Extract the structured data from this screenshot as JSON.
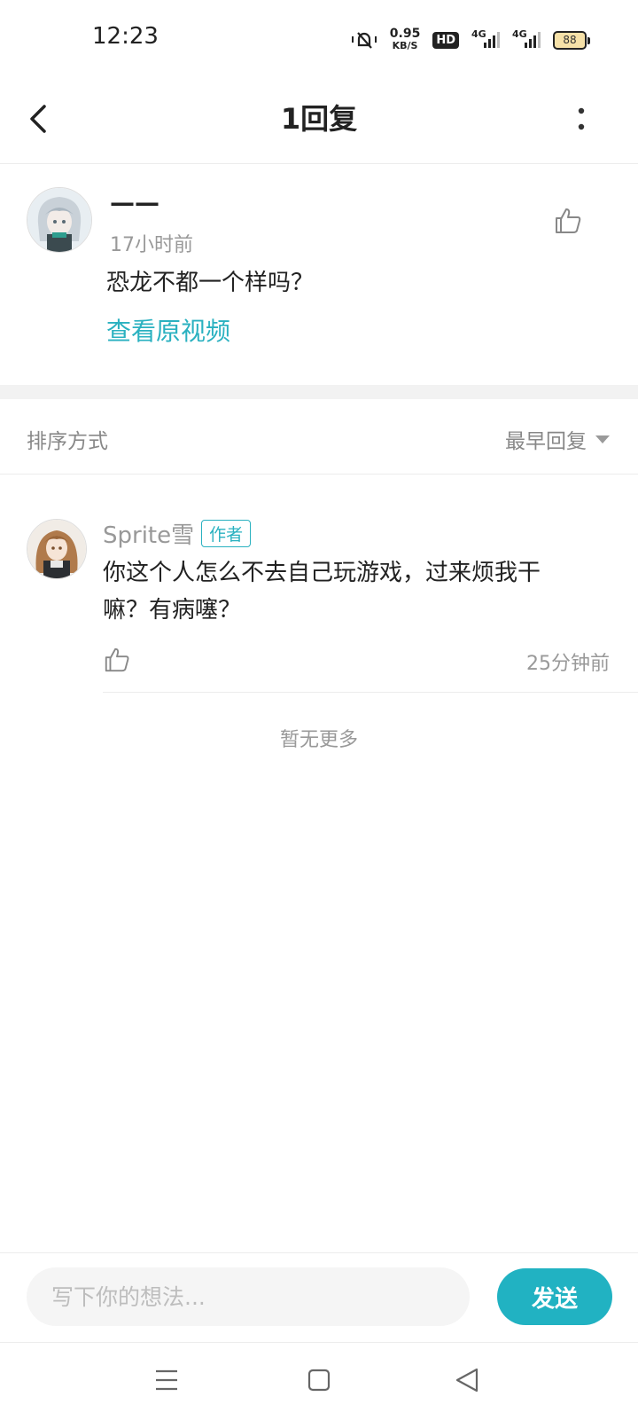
{
  "status_bar": {
    "time": "12:23",
    "net_speed": "0.95",
    "net_speed_unit": "KB/S",
    "hd": "HD",
    "signal1": "4G",
    "signal2": "4G",
    "battery": "88"
  },
  "header": {
    "title": "1回复"
  },
  "original_comment": {
    "user_name": "——",
    "time": "17小时前",
    "text": "恐龙不都一个样吗？",
    "view_original": "查看原视频"
  },
  "sort": {
    "label": "排序方式",
    "selected": "最早回复"
  },
  "reply": {
    "user_name": "Sprite雪",
    "badge": "作者",
    "text": "你这个人怎么不去自己玩游戏，过来烦我干嘛？有病噻？",
    "time": "25分钟前"
  },
  "no_more": "暂无更多",
  "input": {
    "placeholder": "写下你的想法...",
    "send_label": "发送"
  },
  "colors": {
    "accent": "#21b2c2",
    "link": "#2ab1c0"
  }
}
